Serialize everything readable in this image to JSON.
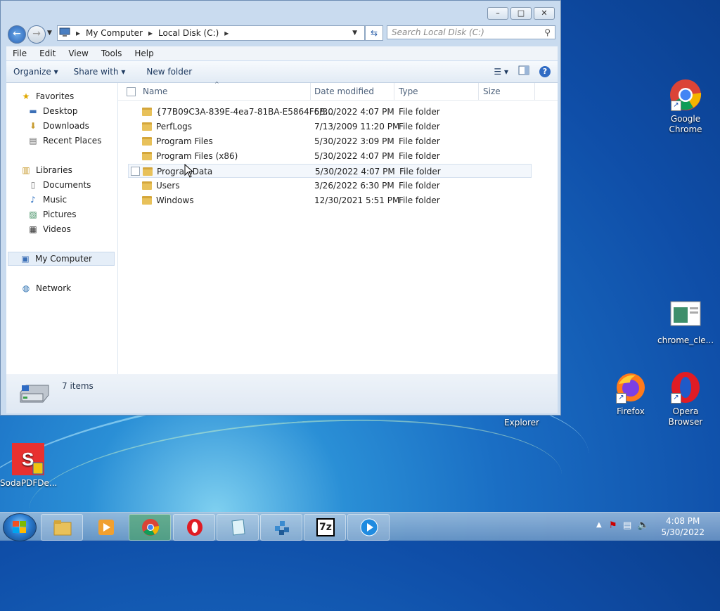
{
  "window": {
    "controls": {
      "minimize": "–",
      "maximize": "□",
      "close": "✕"
    },
    "breadcrumb": [
      "My Computer",
      "Local Disk (C:)"
    ],
    "search_placeholder": "Search Local Disk (C:)",
    "menu": [
      "File",
      "Edit",
      "View",
      "Tools",
      "Help"
    ],
    "commands": {
      "organize": "Organize ▾",
      "share": "Share with ▾",
      "new_folder": "New folder"
    },
    "nav": {
      "favorites": "Favorites",
      "fav_items": [
        "Desktop",
        "Downloads",
        "Recent Places"
      ],
      "libraries": "Libraries",
      "lib_items": [
        "Documents",
        "Music",
        "Pictures",
        "Videos"
      ],
      "computer": "My Computer",
      "network": "Network"
    },
    "columns": {
      "name": "Name",
      "date": "Date modified",
      "type": "Type",
      "size": "Size"
    },
    "files": [
      {
        "name": "{77B09C3A-839E-4ea7-81BA-E5864F6B...",
        "date": "5/30/2022 4:07 PM",
        "type": "File folder"
      },
      {
        "name": "PerfLogs",
        "date": "7/13/2009 11:20 PM",
        "type": "File folder"
      },
      {
        "name": "Program Files",
        "date": "5/30/2022 3:09 PM",
        "type": "File folder"
      },
      {
        "name": "Program Files (x86)",
        "date": "5/30/2022 4:07 PM",
        "type": "File folder"
      },
      {
        "name": "ProgramData",
        "date": "5/30/2022 4:07 PM",
        "type": "File folder"
      },
      {
        "name": "Users",
        "date": "3/26/2022 6:30 PM",
        "type": "File folder"
      },
      {
        "name": "Windows",
        "date": "12/30/2021 5:51 PM",
        "type": "File folder"
      }
    ],
    "status": "7 items"
  },
  "desktop": {
    "icons": {
      "chrome": "Google Chrome",
      "chrome_cle": "chrome_cle...",
      "firefox": "Firefox",
      "opera": "Opera Browser",
      "explorer": "Explorer",
      "soda": "SodaPDFDe..."
    }
  },
  "taskbar": {
    "time": "4:08 PM",
    "date": "5/30/2022",
    "seven_zip": "7z"
  },
  "colors": {
    "accent": "#2f6bc4",
    "folder": "#e8c15a"
  }
}
